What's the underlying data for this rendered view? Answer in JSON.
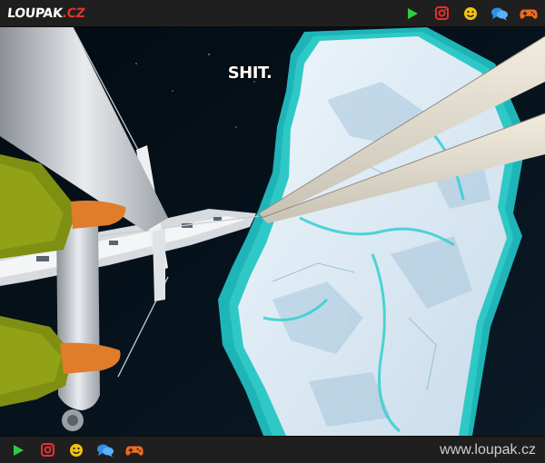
{
  "header": {
    "logo": {
      "main": "LOUPAK",
      "suffix": ".CZ"
    },
    "icons": [
      {
        "name": "play-icon",
        "color": "#2ecc40"
      },
      {
        "name": "instagram-icon",
        "color": "#e8312c"
      },
      {
        "name": "smiley-icon",
        "color": "#f4c20d"
      },
      {
        "name": "chat-icon",
        "color": "#2f8fe8"
      },
      {
        "name": "gamepad-icon",
        "color": "#f26b1d"
      }
    ]
  },
  "image": {
    "caption": "SHIT."
  },
  "footer": {
    "url": "www.loupak.cz"
  },
  "colors": {
    "bar_background": "#1f1f1f",
    "brand_red": "#e8312c"
  }
}
